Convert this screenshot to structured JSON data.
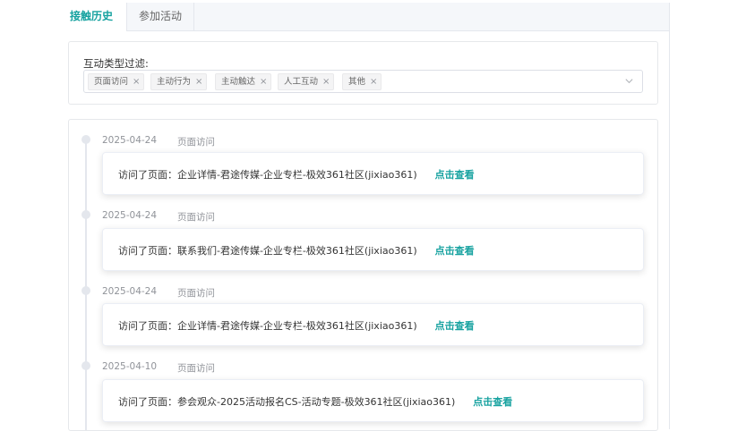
{
  "tabs": [
    {
      "label": "接触历史",
      "active": true
    },
    {
      "label": "参加活动",
      "active": false
    }
  ],
  "filter": {
    "label": "互动类型过滤:",
    "tags": [
      "页面访问",
      "主动行为",
      "主动触达",
      "人工互动",
      "其他"
    ],
    "tag_close": "×"
  },
  "timeline": {
    "items": [
      {
        "date": "2025-04-24",
        "type": "页面访问",
        "text": "访问了页面：企业详情-君途传媒-企业专栏-极效361社区(jixiao361)",
        "link": "点击查看"
      },
      {
        "date": "2025-04-24",
        "type": "页面访问",
        "text": "访问了页面：联系我们-君途传媒-企业专栏-极效361社区(jixiao361)",
        "link": "点击查看"
      },
      {
        "date": "2025-04-24",
        "type": "页面访问",
        "text": "访问了页面：企业详情-君途传媒-企业专栏-极效361社区(jixiao361)",
        "link": "点击查看"
      },
      {
        "date": "2025-04-10",
        "type": "页面访问",
        "text": "访问了页面：参会观众-2025活动报名CS-活动专题-极效361社区(jixiao361)",
        "link": "点击查看"
      }
    ]
  },
  "colors": {
    "accent": "#17a2a0",
    "muted": "#909399"
  }
}
